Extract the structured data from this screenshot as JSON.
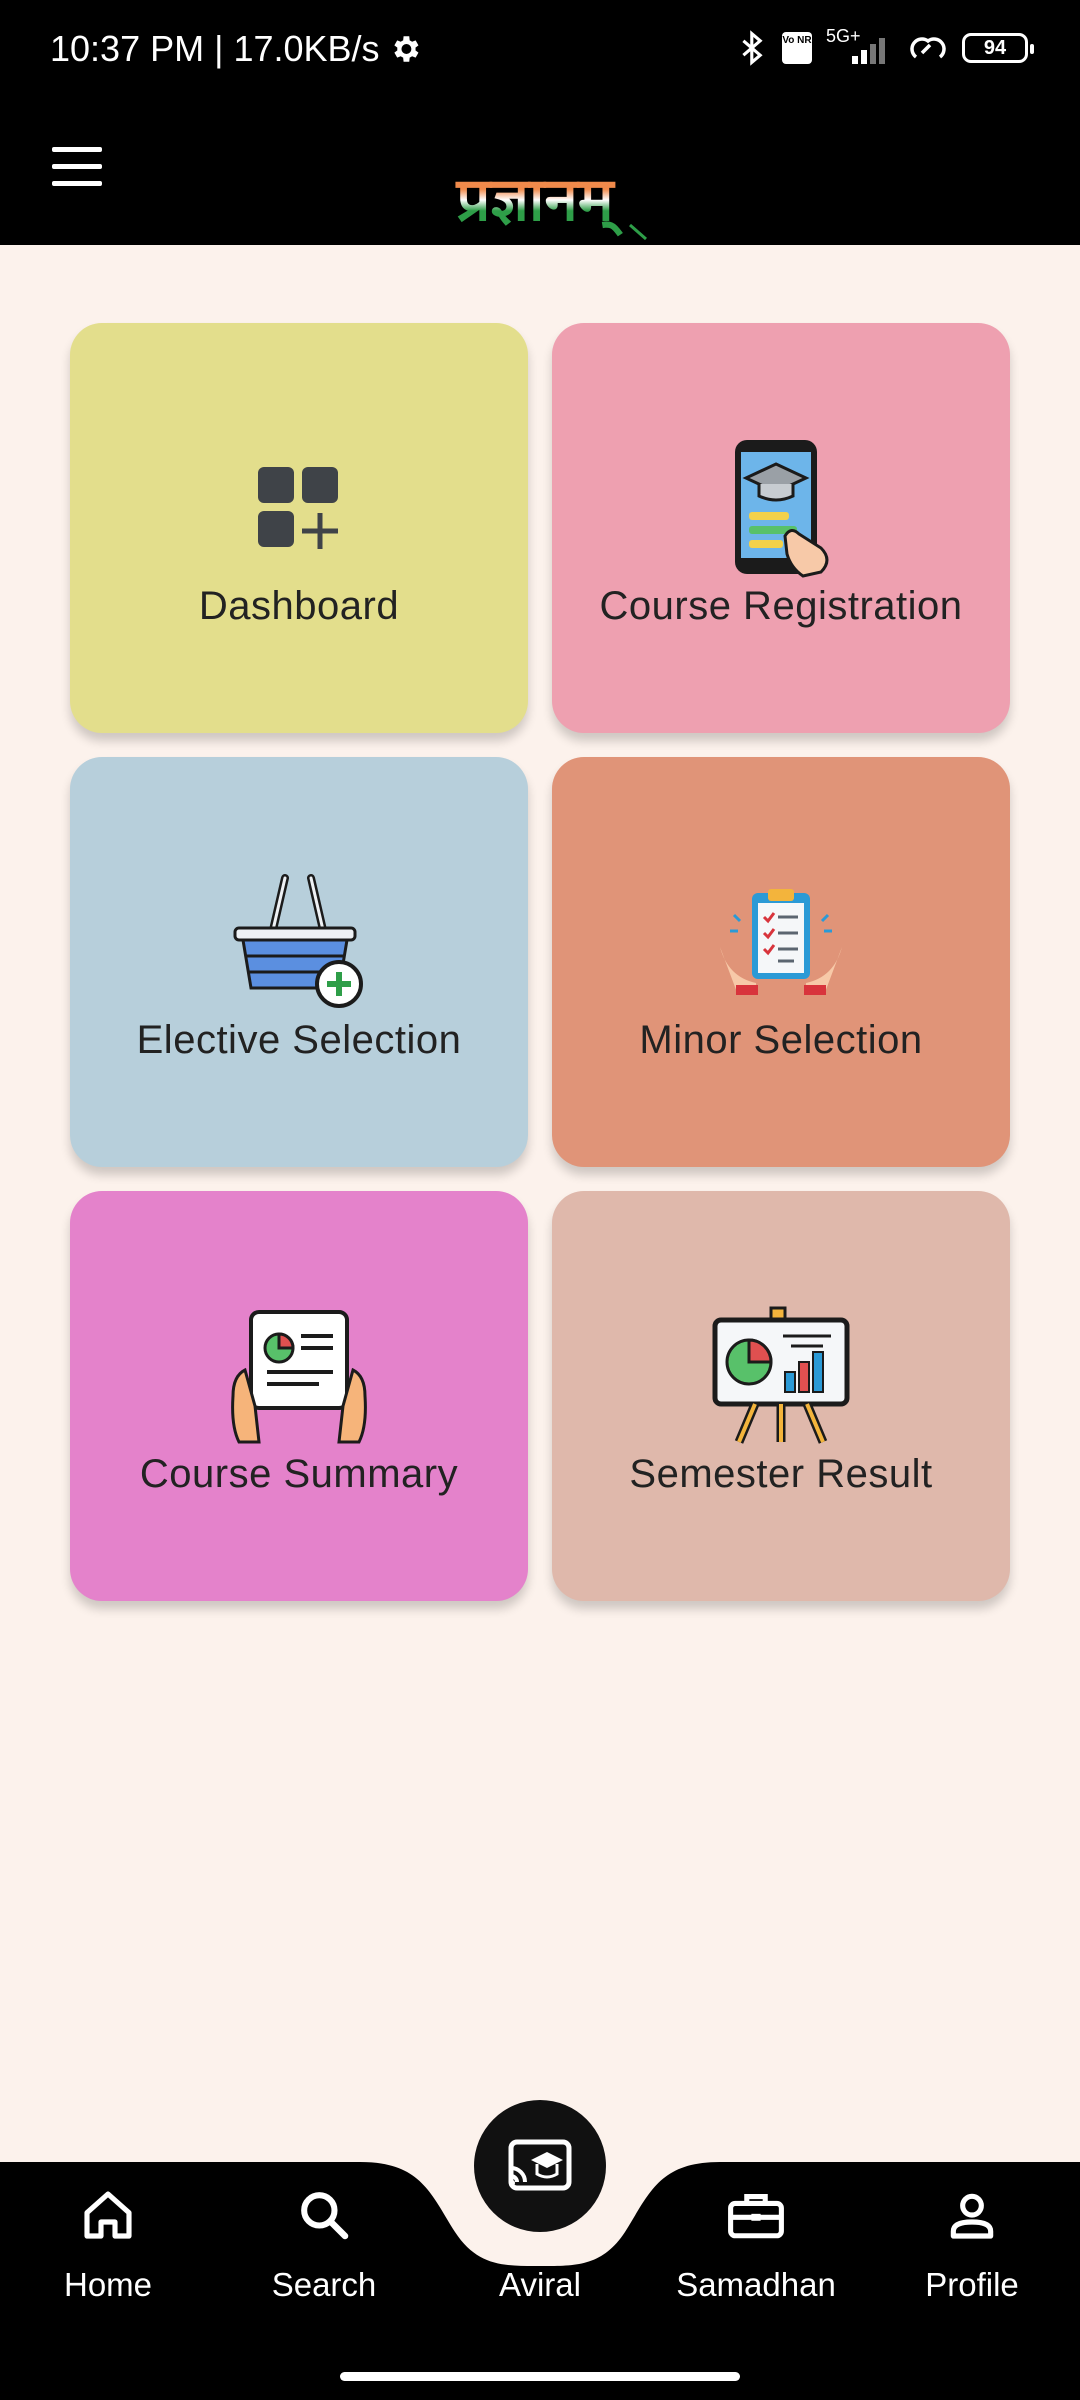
{
  "status": {
    "time_speed": "10:37 PM | 17.0KB/s",
    "network": "5G+",
    "volte": "Vo NR",
    "battery": "94"
  },
  "header": {
    "brand": "प्रज्ञानम्"
  },
  "tiles": [
    {
      "label": "Dashboard",
      "color": "#e3de8c",
      "icon": "dashboard-add-icon"
    },
    {
      "label": "Course Registration",
      "color": "#eea0b0",
      "icon": "phone-graduation-icon"
    },
    {
      "label": "Elective Selection",
      "color": "#b7cfdb",
      "icon": "basket-add-icon"
    },
    {
      "label": "Minor Selection",
      "color": "#e09478",
      "icon": "clipboard-checklist-icon"
    },
    {
      "label": "Course Summary",
      "color": "#e482cb",
      "icon": "report-hands-icon"
    },
    {
      "label": "Semester Result",
      "color": "#dfb8ab",
      "icon": "presentation-board-icon"
    }
  ],
  "nav": {
    "items": [
      {
        "label": "Home",
        "icon": "home-icon"
      },
      {
        "label": "Search",
        "icon": "search-icon"
      },
      {
        "label": "Aviral",
        "icon": "cast-school-icon"
      },
      {
        "label": "Samadhan",
        "icon": "briefcase-icon"
      },
      {
        "label": "Profile",
        "icon": "person-icon"
      }
    ]
  }
}
